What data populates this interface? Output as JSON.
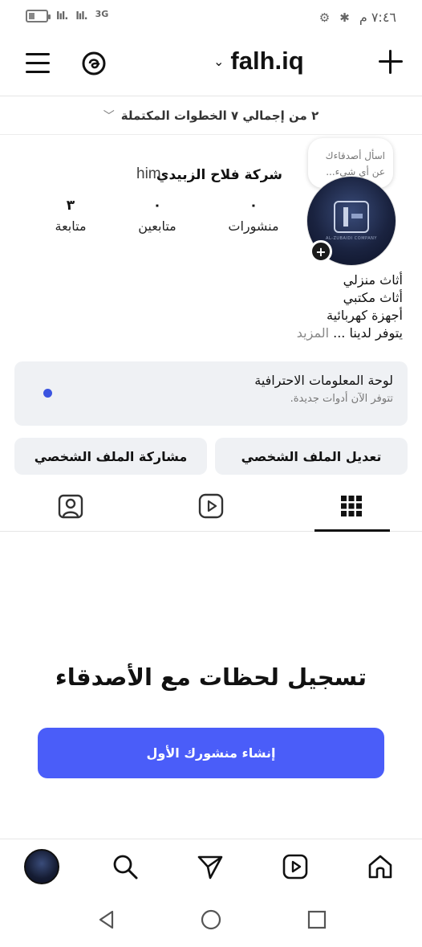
{
  "status_bar": {
    "signal_1": "lıl.",
    "signal_2": "lıl.",
    "network": "3G",
    "time": "٧:٤٦ م",
    "battery_level": 0.35
  },
  "header": {
    "username": "falh.iq"
  },
  "steps": {
    "text": "٢ من إجمالي ٧ الخطوات المكتملة"
  },
  "profile": {
    "note": "اسأل أصدقاءك عن أي شيء...",
    "avatar_caption": "AL-ZUBAIDI COMPANY",
    "display_name": "شركة فلاح الزبيدي",
    "pronoun": "him",
    "stats": {
      "posts": {
        "value": "٠",
        "label": "منشورات"
      },
      "followers": {
        "value": "٠",
        "label": "متابعين"
      },
      "following": {
        "value": "٣",
        "label": "متابعة"
      }
    },
    "bio_lines": [
      "أثاث منزلي",
      "أثاث مكتبي",
      "أجهزة كهربائية"
    ],
    "bio_last": "يتوفر لدينا ...",
    "bio_more": "المزيد"
  },
  "dashboard": {
    "title": "لوحة المعلومات الاحترافية",
    "subtitle": "تتوفر الآن أدوات جديدة."
  },
  "buttons": {
    "edit_profile": "تعديل الملف الشخصي",
    "share_profile": "مشاركة الملف الشخصي"
  },
  "empty_state": {
    "title": "تسجيل لحظات مع الأصدقاء",
    "create_button": "إنشاء منشورك الأول"
  },
  "colors": {
    "accent": "#4a5df9",
    "notification_dot": "#3b54e0",
    "card_bg": "#eff1f4"
  }
}
